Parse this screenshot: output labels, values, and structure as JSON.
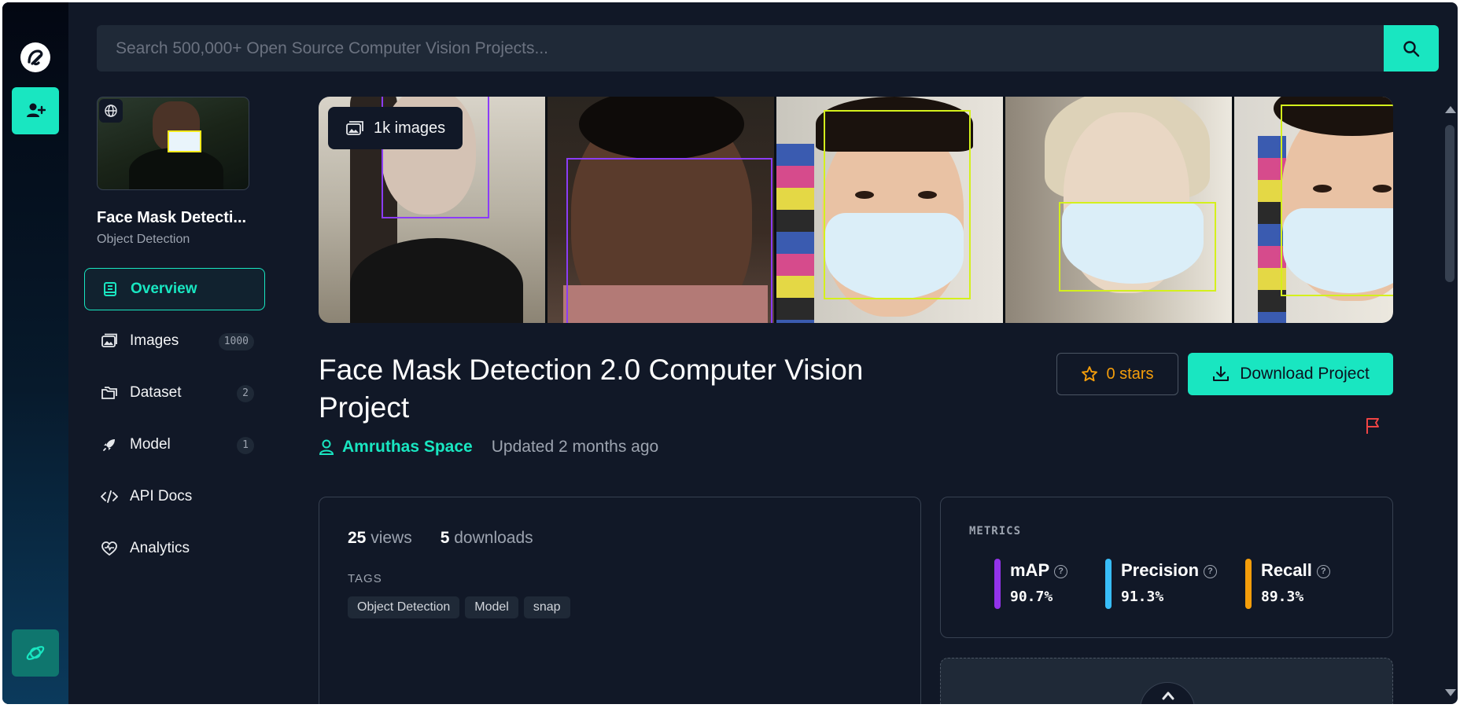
{
  "colors": {
    "accent": "#19e6c1",
    "background": "#111827",
    "star": "#f59e0b",
    "flag": "#ef4444",
    "bbox_purple": "#8b3cf7",
    "bbox_yellow": "#d4f01c"
  },
  "search": {
    "placeholder": "Search 500,000+ Open Source Computer Vision Projects..."
  },
  "project": {
    "name": "Face Mask Detecti...",
    "type": "Object Detection"
  },
  "nav": {
    "items": [
      {
        "label": "Overview",
        "icon": "book-icon",
        "count": null
      },
      {
        "label": "Images",
        "icon": "images-icon",
        "count": "1000"
      },
      {
        "label": "Dataset",
        "icon": "folders-icon",
        "count": "2"
      },
      {
        "label": "Model",
        "icon": "rocket-icon",
        "count": "1"
      },
      {
        "label": "API Docs",
        "icon": "code-icon",
        "count": null
      },
      {
        "label": "Analytics",
        "icon": "heart-pulse-icon",
        "count": null
      }
    ]
  },
  "banner": {
    "images_badge": "1k images"
  },
  "header": {
    "title": "Face Mask Detection 2.0 Computer Vision Project",
    "author": "Amruthas Space",
    "updated": "Updated 2 months ago",
    "stars_label": "0 stars",
    "download_label": "Download Project"
  },
  "stats": {
    "views_count": "25",
    "views_label": "views",
    "downloads_count": "5",
    "downloads_label": "downloads",
    "tags_heading": "TAGS",
    "tags": [
      "Object Detection",
      "Model",
      "snap"
    ]
  },
  "metrics": {
    "heading": "METRICS",
    "items": [
      {
        "name": "mAP",
        "value": "90.7%",
        "color": "#9333ea"
      },
      {
        "name": "Precision",
        "value": "91.3%",
        "color": "#38bdf8"
      },
      {
        "name": "Recall",
        "value": "89.3%",
        "color": "#f59e0b"
      }
    ]
  }
}
